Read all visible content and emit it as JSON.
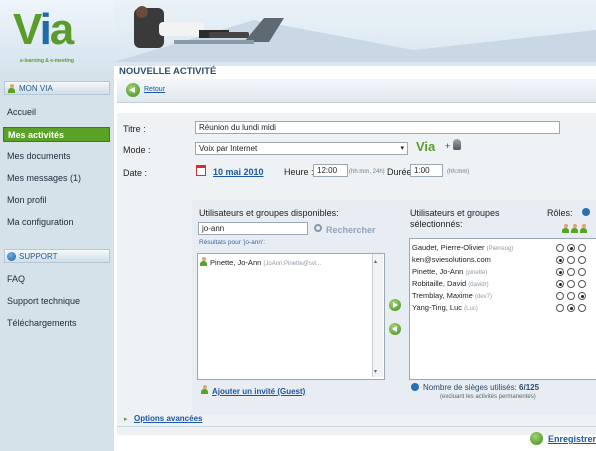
{
  "logo": {
    "v": "V",
    "i": "i",
    "a": "a",
    "tagline": "e-learning & e-meeting"
  },
  "sidebar": {
    "section1": "MON VIA",
    "items": [
      "Accueil",
      "Mes activités",
      "Mes documents",
      "Mes messages (1)",
      "Mon profil",
      "Ma configuration"
    ],
    "section2": "SUPPORT",
    "support_items": [
      "FAQ",
      "Support technique",
      "Téléchargements"
    ]
  },
  "page": {
    "title": "NOUVELLE ACTIVITÉ",
    "back": "Retour"
  },
  "form": {
    "title_label": "Titre :",
    "title_value": "Réunion du lundi midi",
    "mode_label": "Mode :",
    "mode_value": "Voix par Internet",
    "mode_logo": "Via",
    "mode_plus": "+",
    "date_label": "Date :",
    "date_value": "10 mai 2010",
    "heure_label": "Heure :",
    "heure_value": "12:00",
    "heure_hint": "(hh:mm, 24h)",
    "duree_label": "Durée :",
    "duree_value": "1:00",
    "duree_hint": "(hh:mm)"
  },
  "available": {
    "heading": "Utilisateurs et groupes disponibles:",
    "search_value": "jo-ann",
    "search_button": "Rechercher",
    "results_label": "Résultats pour 'jo-ann':",
    "results": [
      {
        "name": "Pinette, Jo-Ann",
        "email": "(JoAnn.Pinette@svi..."
      }
    ],
    "add_guest": "Ajouter un invité (Guest)"
  },
  "selected": {
    "heading": "Utilisateurs et groupes sélectionnés:",
    "roles_label": "Rôles:",
    "rows": [
      {
        "name": "Gaudet, Pierre-Olivier",
        "user": "(Pierreog)",
        "role": 1
      },
      {
        "name": "ken@sviesolutions.com",
        "user": "",
        "role": 0
      },
      {
        "name": "Pinette, Jo-Ann",
        "user": "(pinette)",
        "role": 0
      },
      {
        "name": "Robitaille, David",
        "user": "(davidr)",
        "role": 0
      },
      {
        "name": "Tremblay, Maxime",
        "user": "(dev7)",
        "role": 2
      },
      {
        "name": "Yang-Ting, Luc",
        "user": "(Luc)",
        "role": 1
      }
    ],
    "seats_text": "Nombre de sièges utilisés: ",
    "seats_value": "6/125",
    "seats_note": "(excluant les activités permanentes)"
  },
  "advanced": "Options avancées",
  "save": "Enregistrer"
}
